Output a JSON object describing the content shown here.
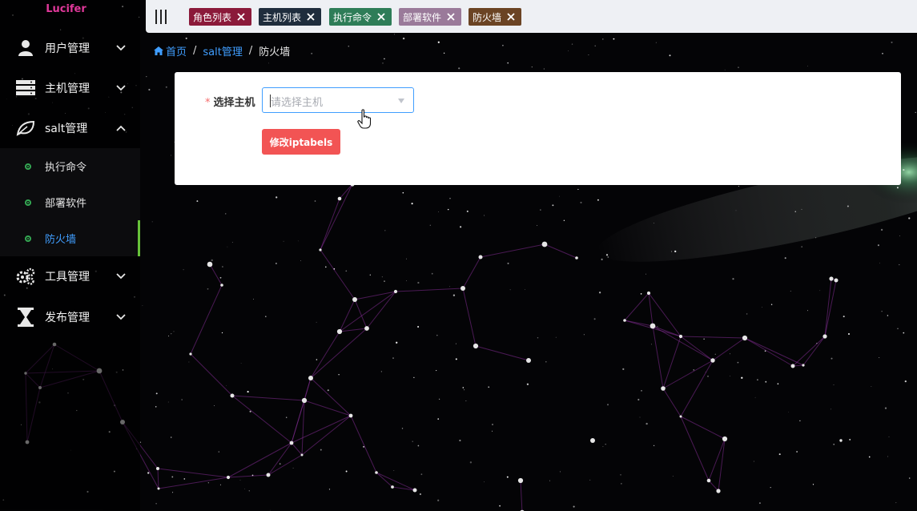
{
  "app": {
    "logo": "Lucifer"
  },
  "sidebar": {
    "items": [
      {
        "label": "用户管理",
        "icon": "user-icon",
        "expanded": false
      },
      {
        "label": "主机管理",
        "icon": "server-icon",
        "expanded": false
      },
      {
        "label": "salt管理",
        "icon": "leaf-icon",
        "expanded": true
      },
      {
        "label": "工具管理",
        "icon": "gears-icon",
        "expanded": false
      },
      {
        "label": "发布管理",
        "icon": "hourglass-icon",
        "expanded": false
      }
    ],
    "subitems": [
      {
        "label": "执行命令",
        "active": false
      },
      {
        "label": "部署软件",
        "active": false
      },
      {
        "label": "防火墙",
        "active": true
      }
    ]
  },
  "tags": [
    {
      "label": "角色列表",
      "color": "#8b1a3a"
    },
    {
      "label": "主机列表",
      "color": "#1f2d3d"
    },
    {
      "label": "执行命令",
      "color": "#2e7d58"
    },
    {
      "label": "部署软件",
      "color": "#9a7a9a"
    },
    {
      "label": "防火墙",
      "color": "#6b4424"
    }
  ],
  "breadcrumb": {
    "home": "首页",
    "parent": "salt管理",
    "current": "防火墙",
    "separator": "/"
  },
  "form": {
    "required_mark": "*",
    "host_label": "选择主机",
    "host_placeholder": "请选择主机",
    "submit_label": "修改iptabels"
  },
  "colors": {
    "accent": "#409eff",
    "danger_button": "#f25454",
    "active_marker": "#67c23a",
    "logo": "#e0389a"
  }
}
